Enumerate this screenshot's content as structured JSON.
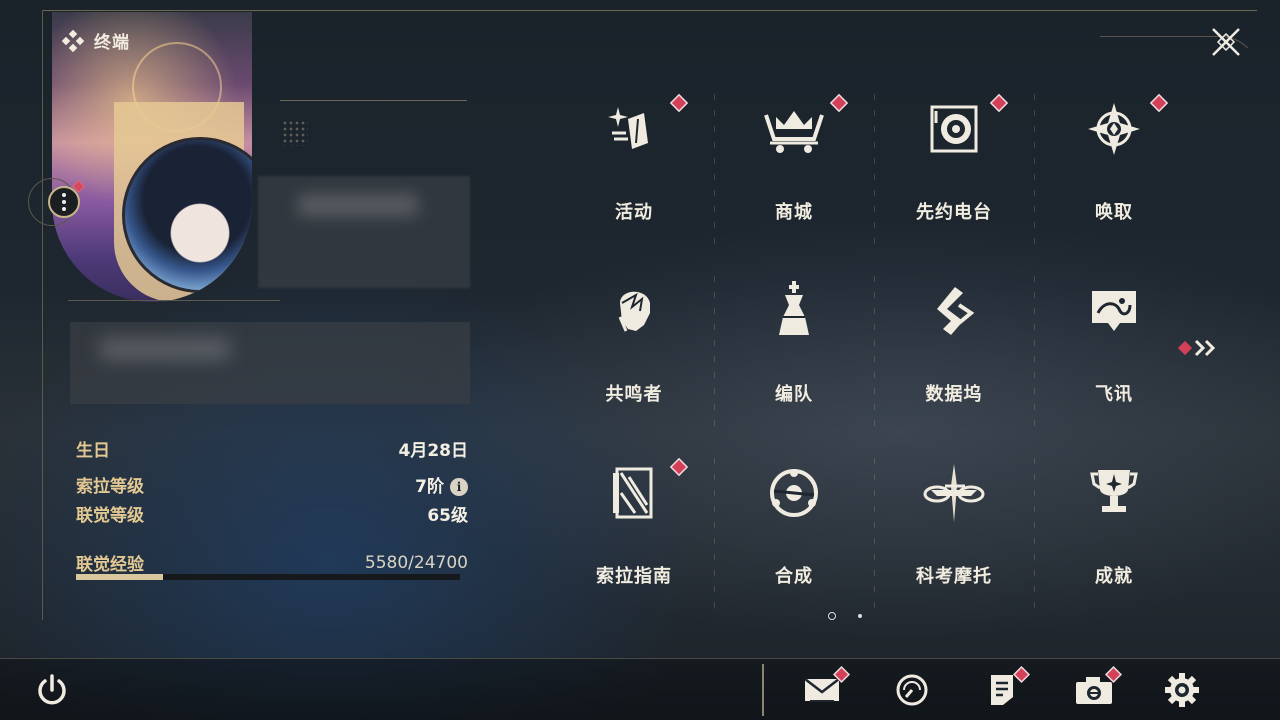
{
  "header": {
    "title": "终端",
    "logo_icon": "diamond-cluster-icon",
    "close_icon": "close-x-icon"
  },
  "profile": {
    "menu_icon": "more-dots-icon",
    "stats": [
      {
        "key": "生日",
        "value": "4月28日"
      },
      {
        "key": "索拉等级",
        "value": "7阶"
      },
      {
        "key": "联觉等级",
        "value": "65级"
      },
      {
        "key": "联觉经验",
        "value": "5580/24700"
      }
    ],
    "exp_progress": 0.2259
  },
  "menu": [
    {
      "label": "活动",
      "icon": "activity-icon",
      "badge": true
    },
    {
      "label": "商城",
      "icon": "shop-cart-icon",
      "badge": true
    },
    {
      "label": "先约电台",
      "icon": "radio-icon",
      "badge": true
    },
    {
      "label": "唤取",
      "icon": "gacha-compass-icon",
      "badge": true
    },
    {
      "label": "共鸣者",
      "icon": "resonator-icon",
      "badge": false
    },
    {
      "label": "编队",
      "icon": "team-chess-icon",
      "badge": false
    },
    {
      "label": "数据坞",
      "icon": "data-dock-icon",
      "badge": false
    },
    {
      "label": "飞讯",
      "icon": "message-icon",
      "badge": false
    },
    {
      "label": "索拉指南",
      "icon": "guide-book-icon",
      "badge": true
    },
    {
      "label": "合成",
      "icon": "synthesis-icon",
      "badge": false
    },
    {
      "label": "科考摩托",
      "icon": "motorbike-icon",
      "badge": false
    },
    {
      "label": "成就",
      "icon": "trophy-icon",
      "badge": false
    }
  ],
  "pagination": {
    "current": 1,
    "total": 2
  },
  "colors": {
    "accent": "#e2c892",
    "badge": "#d24158",
    "text": "#f1ece0"
  },
  "bottom_bar": [
    {
      "icon": "power-icon",
      "badge": false
    },
    {
      "icon": "mail-icon",
      "badge": true
    },
    {
      "icon": "clock-icon",
      "badge": false
    },
    {
      "icon": "notes-icon",
      "badge": true
    },
    {
      "icon": "camera-icon",
      "badge": true
    },
    {
      "icon": "settings-gear-icon",
      "badge": false
    }
  ]
}
